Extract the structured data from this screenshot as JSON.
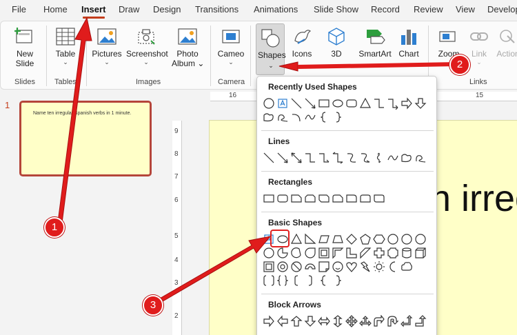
{
  "tabs": [
    "File",
    "Home",
    "Insert",
    "Draw",
    "Design",
    "Transitions",
    "Animations",
    "Slide Show",
    "Record",
    "Review",
    "View",
    "Develop"
  ],
  "active_tab": "Insert",
  "ribbon": {
    "new_slide": "New",
    "new_slide_2": "Slide",
    "table": "Table",
    "pictures": "Pictures",
    "screenshot": "Screenshot",
    "photo_album": "Photo",
    "photo_album_2": "Album",
    "cameo": "Cameo",
    "shapes": "Shapes",
    "icons": "Icons",
    "threed": "3D",
    "smartart": "SmartArt",
    "chart": "Chart",
    "zoom": "Zoom",
    "link": "Link",
    "action": "Action",
    "groups": {
      "slides": "Slides",
      "tables": "Tables",
      "images": "Images",
      "camera": "Camera",
      "links": "Links"
    }
  },
  "ruler": {
    "h": [
      "16",
      "15"
    ],
    "v": [
      "9",
      "8",
      "7",
      "6",
      "5",
      "4",
      "3",
      "2"
    ]
  },
  "thumbnail": {
    "number": "1",
    "text": "Name ten irregular Spanish verbs in 1 minute."
  },
  "slide_text": "n irreg",
  "dropdown": {
    "recently_used": "Recently Used Shapes",
    "lines": "Lines",
    "rectangles": "Rectangles",
    "basic_shapes": "Basic Shapes",
    "block_arrows": "Block Arrows"
  },
  "callouts": [
    "1",
    "2",
    "3"
  ],
  "colors": {
    "accent": "#c43e1c",
    "callout": "#e01c1c",
    "slide_bg": "#ffffc8"
  }
}
